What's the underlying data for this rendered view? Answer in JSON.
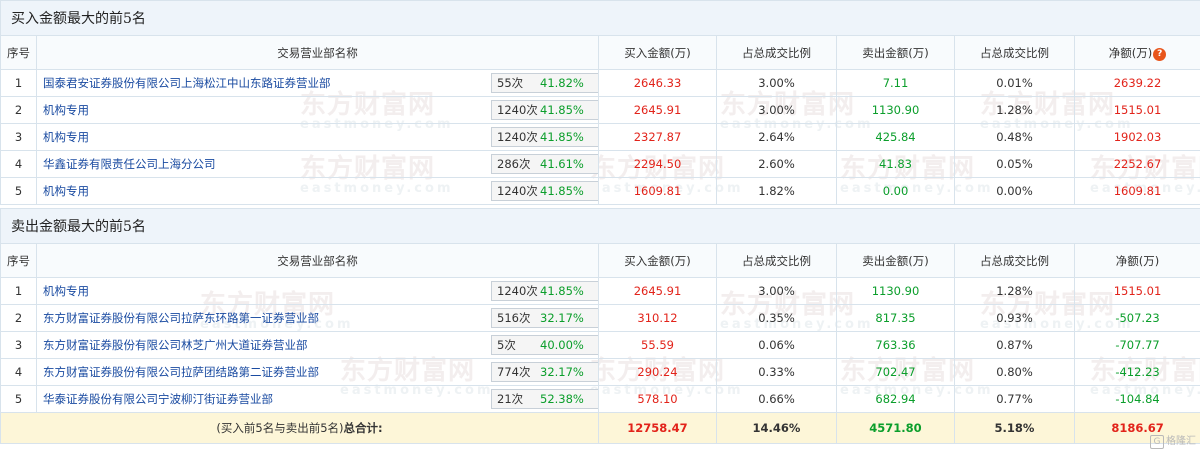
{
  "watermark": {
    "cn": "东方财富网",
    "en": "eastmoney.com"
  },
  "buy": {
    "title": "买入金额最大的前5名",
    "headers": {
      "idx": "序号",
      "name": "交易营业部名称",
      "buy": "买入金额(万)",
      "buy_pct": "占总成交比例",
      "sell": "卖出金额(万)",
      "sell_pct": "占总成交比例",
      "net": "净额(万)"
    },
    "rows": [
      {
        "idx": "1",
        "name": "国泰君安证券股份有限公司上海松江中山东路证券营业部",
        "count": "55次",
        "rate": "41.82%",
        "icon": "question-icon",
        "buy": "2646.33",
        "buy_pct": "3.00%",
        "sell": "7.11",
        "sell_pct": "0.01%",
        "net": "2639.22"
      },
      {
        "idx": "2",
        "name": "机构专用",
        "count": "1240次",
        "rate": "41.85%",
        "icon": "arrow-right-icon",
        "buy": "2645.91",
        "buy_pct": "3.00%",
        "sell": "1130.90",
        "sell_pct": "1.28%",
        "net": "1515.01"
      },
      {
        "idx": "3",
        "name": "机构专用",
        "count": "1240次",
        "rate": "41.85%",
        "icon": "arrow-right-icon",
        "buy": "2327.87",
        "buy_pct": "2.64%",
        "sell": "425.84",
        "sell_pct": "0.48%",
        "net": "1902.03"
      },
      {
        "idx": "4",
        "name": "华鑫证券有限责任公司上海分公司",
        "count": "286次",
        "rate": "41.61%",
        "icon": "arrow-right-icon",
        "buy": "2294.50",
        "buy_pct": "2.60%",
        "sell": "41.83",
        "sell_pct": "0.05%",
        "net": "2252.67"
      },
      {
        "idx": "5",
        "name": "机构专用",
        "count": "1240次",
        "rate": "41.85%",
        "icon": "arrow-right-icon",
        "buy": "1609.81",
        "buy_pct": "1.82%",
        "sell": "0.00",
        "sell_pct": "0.00%",
        "net": "1609.81"
      }
    ]
  },
  "sell": {
    "title": "卖出金额最大的前5名",
    "headers": {
      "idx": "序号",
      "name": "交易营业部名称",
      "buy": "买入金额(万)",
      "buy_pct": "占总成交比例",
      "sell": "卖出金额(万)",
      "sell_pct": "占总成交比例",
      "net": "净额(万)"
    },
    "rows": [
      {
        "idx": "1",
        "name": "机构专用",
        "count": "1240次",
        "rate": "41.85%",
        "icon": "question-icon",
        "buy": "2645.91",
        "buy_pct": "3.00%",
        "sell": "1130.90",
        "sell_pct": "1.28%",
        "net": "1515.01"
      },
      {
        "idx": "2",
        "name": "东方财富证券股份有限公司拉萨东环路第一证券营业部",
        "count": "516次",
        "rate": "32.17%",
        "icon": "arrow-right-icon",
        "buy": "310.12",
        "buy_pct": "0.35%",
        "sell": "817.35",
        "sell_pct": "0.93%",
        "net": "-507.23"
      },
      {
        "idx": "3",
        "name": "东方财富证券股份有限公司林芝广州大道证券营业部",
        "count": "5次",
        "rate": "40.00%",
        "icon": "arrow-right-icon",
        "buy": "55.59",
        "buy_pct": "0.06%",
        "sell": "763.36",
        "sell_pct": "0.87%",
        "net": "-707.77"
      },
      {
        "idx": "4",
        "name": "东方财富证券股份有限公司拉萨团结路第二证券营业部",
        "count": "774次",
        "rate": "32.17%",
        "icon": "arrow-right-icon",
        "buy": "290.24",
        "buy_pct": "0.33%",
        "sell": "702.47",
        "sell_pct": "0.80%",
        "net": "-412.23"
      },
      {
        "idx": "5",
        "name": "华泰证券股份有限公司宁波柳汀街证券营业部",
        "count": "21次",
        "rate": "52.38%",
        "icon": "arrow-right-icon",
        "buy": "578.10",
        "buy_pct": "0.66%",
        "sell": "682.94",
        "sell_pct": "0.77%",
        "net": "-104.84"
      }
    ]
  },
  "total": {
    "label_pre": "(买入前5名与卖出前5名)",
    "label_bold": "总合计:",
    "buy": "12758.47",
    "buy_pct": "14.46%",
    "sell": "4571.80",
    "sell_pct": "5.18%",
    "net": "8186.67"
  },
  "brand": {
    "mark": "G",
    "text": "格隆汇"
  },
  "colors": {
    "positive": "#e2231a",
    "negative": "#0b9e2b",
    "link": "#1a4ba1",
    "section_bg": "#eef4fa",
    "total_bg": "#fdf6d8",
    "hint_icon": "#e8551b"
  }
}
